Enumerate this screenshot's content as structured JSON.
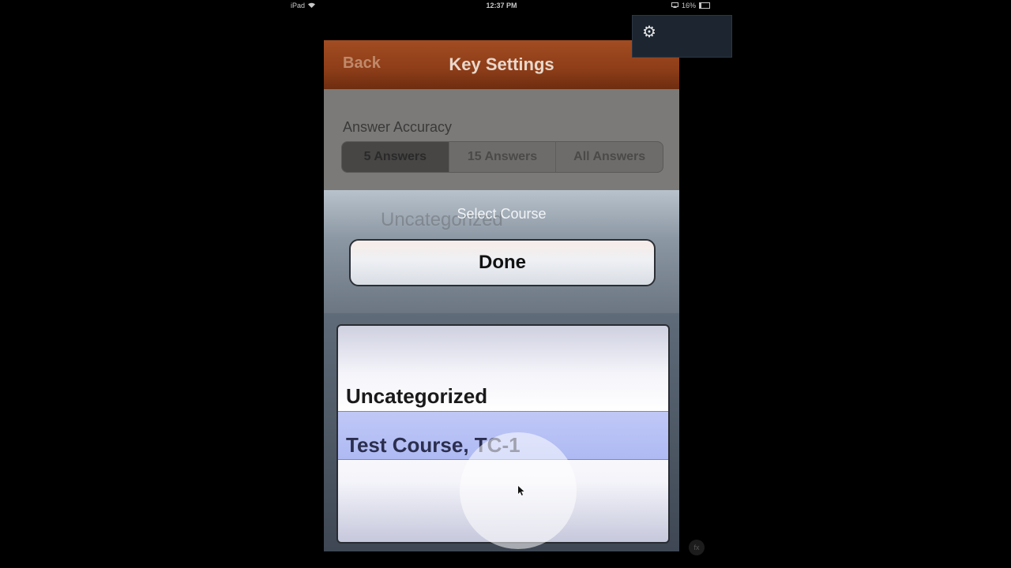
{
  "status_bar": {
    "device": "iPad",
    "time": "12:37 PM",
    "battery": "16%"
  },
  "navbar": {
    "back_label": "Back",
    "title": "Key Settings"
  },
  "answer_accuracy": {
    "label": "Answer Accuracy",
    "options": [
      "5 Answers",
      "15 Answers",
      "All Answers"
    ],
    "selected": "5 Answers"
  },
  "background_field": {
    "value": "Uncategorized"
  },
  "action_sheet": {
    "title": "Select Course",
    "done_label": "Done"
  },
  "picker": {
    "options": [
      "Uncategorized",
      "Test Course, TC-1"
    ],
    "selected": "Test Course, TC-1"
  },
  "overlay": {
    "badge": "fx"
  },
  "icons": {
    "gear": "gear-icon",
    "wifi": "wifi-icon",
    "battery": "battery-icon",
    "cursor": "cursor-icon"
  }
}
